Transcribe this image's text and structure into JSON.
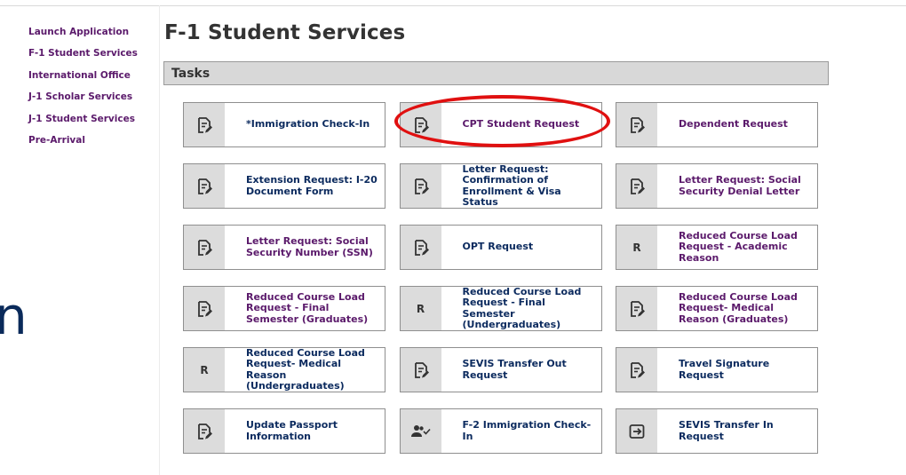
{
  "sidebar": {
    "items": [
      {
        "label": "Launch Application"
      },
      {
        "label": "F-1 Student Services"
      },
      {
        "label": "International Office"
      },
      {
        "label": "J-1 Scholar Services"
      },
      {
        "label": "J-1 Student Services"
      },
      {
        "label": "Pre-Arrival"
      }
    ]
  },
  "page": {
    "title": "F-1 Student Services",
    "section_header": "Tasks",
    "edge_glyph": "n"
  },
  "tasks": [
    {
      "label": "*Immigration Check-In",
      "icon": "document-edit-icon",
      "color": "#0b2a5e"
    },
    {
      "label": "CPT Student Request",
      "icon": "document-edit-icon",
      "color": "#5b1a6b"
    },
    {
      "label": "Dependent Request",
      "icon": "document-edit-icon",
      "color": "#5b1a6b"
    },
    {
      "label": "Extension Request: I-20 Document Form",
      "icon": "document-edit-icon",
      "color": "#0b2a5e"
    },
    {
      "label": "Letter Request: Confirmation of Enrollment & Visa Status",
      "icon": "document-edit-icon",
      "color": "#0b2a5e"
    },
    {
      "label": "Letter Request: Social Security Denial Letter",
      "icon": "document-edit-icon",
      "color": "#5b1a6b"
    },
    {
      "label": "Letter Request: Social Security Number (SSN)",
      "icon": "document-edit-icon",
      "color": "#5b1a6b"
    },
    {
      "label": "OPT Request",
      "icon": "document-edit-icon",
      "color": "#0b2a5e"
    },
    {
      "label": "Reduced Course Load Request - Academic Reason",
      "icon": "letter-r-icon",
      "icon_text": "R",
      "color": "#5b1a6b"
    },
    {
      "label": "Reduced Course Load Request - Final Semester (Graduates)",
      "icon": "document-edit-icon",
      "color": "#5b1a6b"
    },
    {
      "label": "Reduced Course Load Request - Final Semester (Undergraduates)",
      "icon": "letter-r-icon",
      "icon_text": "R",
      "color": "#0b2a5e"
    },
    {
      "label": "Reduced Course Load Request- Medical Reason (Graduates)",
      "icon": "document-edit-icon",
      "color": "#5b1a6b"
    },
    {
      "label": "Reduced Course Load Request- Medical Reason (Undergraduates)",
      "icon": "letter-r-icon",
      "icon_text": "R",
      "color": "#0b2a5e"
    },
    {
      "label": "SEVIS Transfer Out Request",
      "icon": "document-edit-icon",
      "color": "#0b2a5e"
    },
    {
      "label": "Travel Signature Request",
      "icon": "document-edit-icon",
      "color": "#0b2a5e"
    },
    {
      "label": "Update Passport Information",
      "icon": "document-edit-icon",
      "color": "#0b2a5e"
    },
    {
      "label": "F-2 Immigration Check-In",
      "icon": "person-check-icon",
      "color": "#0b2a5e"
    },
    {
      "label": "SEVIS Transfer In Request",
      "icon": "transfer-in-icon",
      "color": "#0b2a5e"
    }
  ],
  "colors": {
    "sidebar_link": "#5b1a6b",
    "tile_purple": "#5b1a6b",
    "tile_navy": "#0b2a5e",
    "highlight": "#e01010",
    "header_bg": "#d8d8d8"
  }
}
